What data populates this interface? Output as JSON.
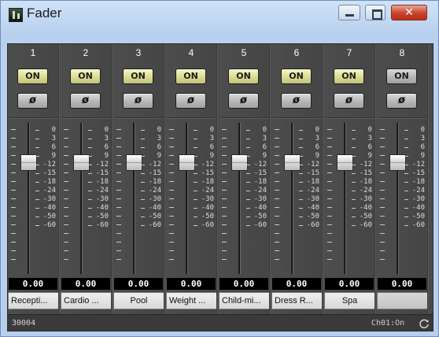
{
  "window": {
    "title": "Fader",
    "close_label": "✕"
  },
  "scale_labels": [
    "0",
    "3",
    "6",
    "9",
    "-12",
    "-15",
    "-18",
    "-24",
    "-30",
    "-40",
    "-50",
    "-60"
  ],
  "channels": [
    {
      "number": "1",
      "on_label": "ON",
      "phase_label": "ø",
      "value": "0.00",
      "name": "Recepti...",
      "on_active": true
    },
    {
      "number": "2",
      "on_label": "ON",
      "phase_label": "ø",
      "value": "0.00",
      "name": "Cardio ...",
      "on_active": true
    },
    {
      "number": "3",
      "on_label": "ON",
      "phase_label": "ø",
      "value": "0.00",
      "name": "Pool",
      "on_active": true
    },
    {
      "number": "4",
      "on_label": "ON",
      "phase_label": "ø",
      "value": "0.00",
      "name": "Weight ...",
      "on_active": true
    },
    {
      "number": "5",
      "on_label": "ON",
      "phase_label": "ø",
      "value": "0.00",
      "name": "Child-mi...",
      "on_active": true
    },
    {
      "number": "6",
      "on_label": "ON",
      "phase_label": "ø",
      "value": "0.00",
      "name": "Dress R...",
      "on_active": true
    },
    {
      "number": "7",
      "on_label": "ON",
      "phase_label": "ø",
      "value": "0.00",
      "name": "Spa",
      "on_active": true
    },
    {
      "number": "8",
      "on_label": "ON",
      "phase_label": "ø",
      "value": "0.00",
      "name": "",
      "on_active": false
    }
  ],
  "status": {
    "left": "30004",
    "right": "Ch01:On"
  },
  "icons": {
    "app": "fader-app-icon",
    "refresh": "refresh-icon"
  }
}
